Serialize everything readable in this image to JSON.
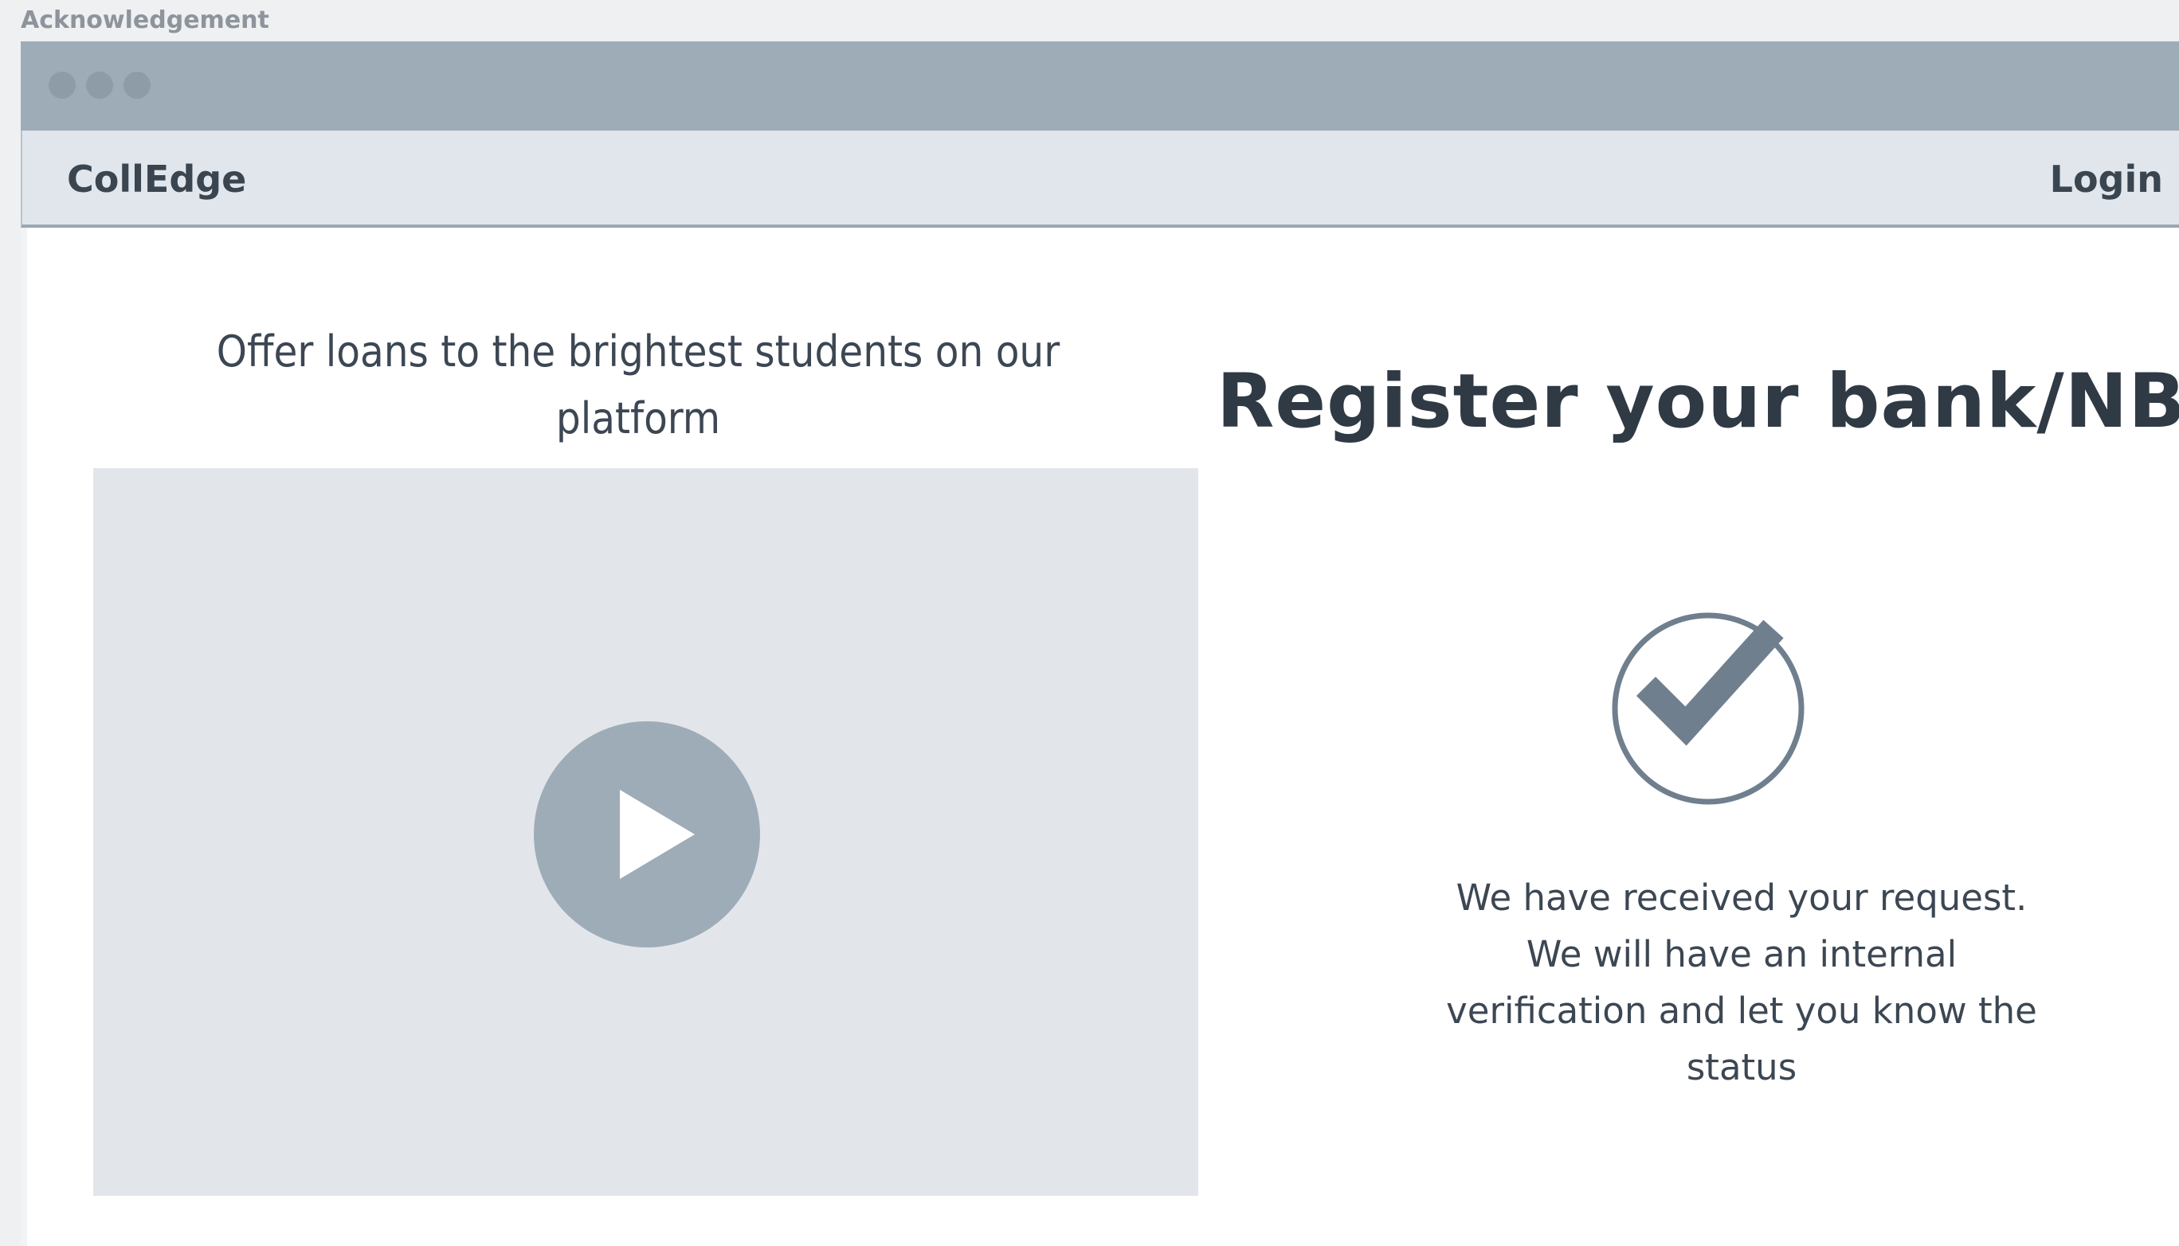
{
  "frame": {
    "label": "Acknowledgement"
  },
  "navbar": {
    "brand": "CollEdge",
    "login_label": "Login"
  },
  "left_panel": {
    "tagline": "Offer loans to the brightest students on our platform"
  },
  "right_panel": {
    "title": "Register your bank/NBFC",
    "message": "We have received your request. We will have an internal verification and let you know the status"
  },
  "colors": {
    "titlebar": "#9eacb8",
    "navbar": "#e0e6ec",
    "video_bg": "#e2e6eb",
    "icon": "#6f7f8e",
    "text": "#3c4753"
  },
  "icons": {
    "play": "play-icon",
    "check": "check-circle-icon"
  }
}
